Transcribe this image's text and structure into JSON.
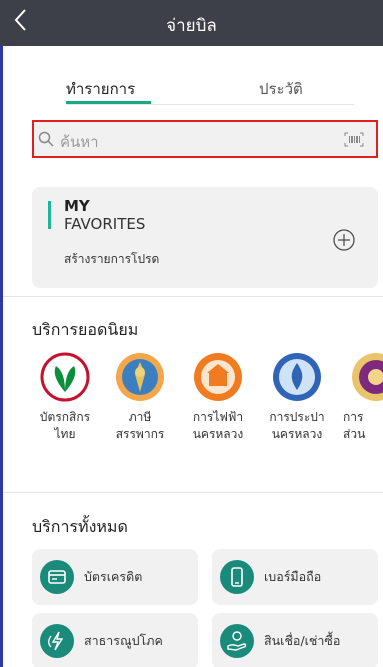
{
  "header": {
    "back_icon": "chevron-left-icon",
    "title": "จ่ายบิล"
  },
  "tabs": [
    {
      "label": "ทำรายการ",
      "active": true
    },
    {
      "label": "ประวัติ",
      "active": false
    }
  ],
  "search": {
    "placeholder": "ค้นหา",
    "icon": "search-icon",
    "scan_icon": "barcode-scan-icon"
  },
  "favorites": {
    "title_line1": "MY",
    "title_line2": "FAVORITES",
    "subtitle": "สร้างรายการโปรด",
    "add_icon": "plus-circle-icon"
  },
  "popular": {
    "title": "บริการยอดนิยม",
    "items": [
      {
        "line1": "บัตรกสิกร",
        "line2": "ไทย",
        "logo": "kbank-logo-icon"
      },
      {
        "line1": "ภาษี",
        "line2": "สรรพากร",
        "logo": "revenue-department-logo-icon"
      },
      {
        "line1": "การไฟฟ้า",
        "line2": "นครหลวง",
        "logo": "mea-logo-icon"
      },
      {
        "line1": "การประปา",
        "line2": "นครหลวง",
        "logo": "mwa-logo-icon"
      },
      {
        "line1": "การ",
        "line2": "ส่วน",
        "logo": "government-seal-icon"
      }
    ]
  },
  "all_services": {
    "title": "บริการทั้งหมด",
    "items": [
      {
        "label": "บัตรเครดิต",
        "icon": "credit-card-icon"
      },
      {
        "label": "เบอร์มือถือ",
        "icon": "mobile-phone-icon"
      },
      {
        "label": "สาธารณูปโภค",
        "icon": "utilities-icon"
      },
      {
        "label": "สินเชื่อ/เช่าซื้อ",
        "icon": "loan-hand-icon"
      }
    ]
  },
  "colors": {
    "header_bg": "#3d4048",
    "accent_green": "#1aa886",
    "search_highlight": "#e02020",
    "icon_teal": "#1a8b7b"
  }
}
